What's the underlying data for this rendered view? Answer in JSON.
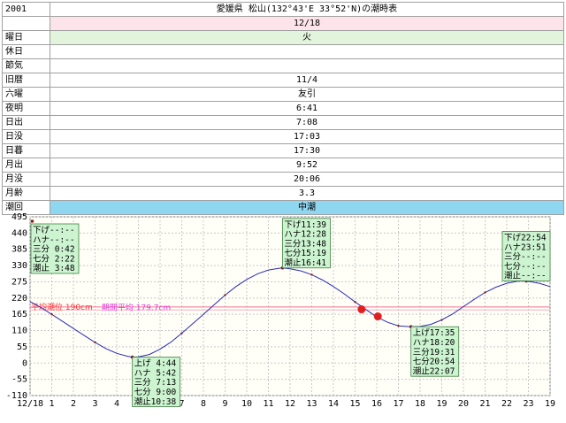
{
  "header": {
    "year": "2001",
    "title": "愛媛県 松山(132°43'E 33°52'N)の潮時表"
  },
  "rows": [
    {
      "label": "",
      "value": "12/18",
      "bg": "#fde4ea"
    },
    {
      "label": "曜日",
      "value": "火",
      "bg": "#e2f4dc"
    },
    {
      "label": "休日",
      "value": "",
      "bg": "#ffffff"
    },
    {
      "label": "節気",
      "value": "",
      "bg": "#ffffff"
    },
    {
      "label": "旧暦",
      "value": "11/4",
      "bg": "#ffffff"
    },
    {
      "label": "六曜",
      "value": "友引",
      "bg": "#ffffff"
    },
    {
      "label": "夜明",
      "value": "6:41",
      "bg": "#ffffff"
    },
    {
      "label": "日出",
      "value": "7:08",
      "bg": "#ffffff"
    },
    {
      "label": "日没",
      "value": "17:03",
      "bg": "#ffffff"
    },
    {
      "label": "日暮",
      "value": "17:30",
      "bg": "#ffffff"
    },
    {
      "label": "月出",
      "value": "9:52",
      "bg": "#ffffff"
    },
    {
      "label": "月没",
      "value": "20:06",
      "bg": "#ffffff"
    },
    {
      "label": "月齢",
      "value": "3.3",
      "bg": "#ffffff"
    },
    {
      "label": "潮回",
      "value": "中潮",
      "bg": "#8fd6f0"
    }
  ],
  "chart_data": {
    "type": "line",
    "x_tick_labels": [
      "12/18",
      "1",
      "2",
      "3",
      "4",
      "5",
      "6",
      "7",
      "8",
      "9",
      "10",
      "11",
      "12",
      "13",
      "14",
      "15",
      "16",
      "17",
      "18",
      "19",
      "20",
      "21",
      "22",
      "23",
      "19"
    ],
    "y_ticks": [
      495,
      440,
      385,
      330,
      275,
      220,
      165,
      110,
      55,
      0,
      -55,
      -110
    ],
    "xlim": [
      0,
      24
    ],
    "ylim": [
      -110,
      495
    ],
    "mean_sea_level": {
      "label": "平均潮位 190cm",
      "value": 190
    },
    "period_mean": {
      "label": "期間平均 179.7cm",
      "value": 179.7
    },
    "series": [
      {
        "x": [
          0.0,
          0.5,
          1.0,
          1.5,
          2.0,
          2.5,
          3.0,
          3.5,
          4.0,
          4.5,
          4.72,
          5.0,
          5.5,
          6.0,
          6.5,
          7.0,
          7.5,
          8.0,
          8.5,
          9.0,
          9.5,
          10.0,
          10.5,
          11.0,
          11.5,
          11.65,
          12.0,
          12.5,
          13.0,
          13.5,
          14.0,
          14.5,
          15.0,
          15.5,
          16.0,
          16.5,
          17.0,
          17.58,
          18.0,
          18.5,
          19.0,
          19.5,
          20.0,
          20.5,
          21.0,
          21.5,
          22.0,
          22.5,
          22.9,
          23.5,
          24.0
        ],
        "y": [
          208,
          188,
          165,
          141,
          117,
          93,
          70,
          49,
          33,
          23,
          20,
          21,
          29,
          47,
          71,
          101,
          133,
          165,
          198,
          230,
          259,
          283,
          302,
          315,
          321,
          322,
          319,
          312,
          299,
          281,
          259,
          234,
          207,
          181,
          156,
          138,
          126,
          123,
          124,
          131,
          146,
          166,
          191,
          216,
          239,
          257,
          270,
          277,
          278,
          270,
          259
        ]
      }
    ],
    "tide_labels": [
      {
        "x": 0.1,
        "y": 480,
        "lines": [
          "下げ--:--",
          "ハナ--:--",
          "三分 0:42",
          "七分 2:22",
          "潮止 3:48"
        ]
      },
      {
        "x": 4.72,
        "y": 20,
        "lines": [
          "上げ 4:44",
          "ハナ 5:42",
          "三分 7:13",
          "七分 9:00",
          "潮止10:38"
        ]
      },
      {
        "x": 11.65,
        "y": 322,
        "lines": [
          "下げ11:39",
          "ハナ12:28",
          "三分13:48",
          "七分15:19",
          "潮止16:41"
        ]
      },
      {
        "x": 17.58,
        "y": 123,
        "lines": [
          "上げ17:35",
          "ハナ18:20",
          "三分19:31",
          "七分20:54",
          "潮止22:07"
        ]
      },
      {
        "x": 22.9,
        "y": 278,
        "lines": [
          "下げ22:54",
          "ハナ23:51",
          "三分--:--",
          "七分--:--",
          "潮止--:--"
        ]
      }
    ],
    "markers": [
      {
        "x": 15.3,
        "y": 182
      },
      {
        "x": 16.05,
        "y": 158
      }
    ],
    "colors": {
      "curve": "#2a2ab8",
      "point": "#8b1a1a",
      "marker": "#e02020",
      "mean_line": "#f07090",
      "period_line": "#f0b0c0",
      "mean_text": "#ff3030",
      "period_text": "#e040e0",
      "label_bg": "#ccf4d0",
      "plot_bg": "#fffff8",
      "grid": "#c8c8c8"
    }
  }
}
